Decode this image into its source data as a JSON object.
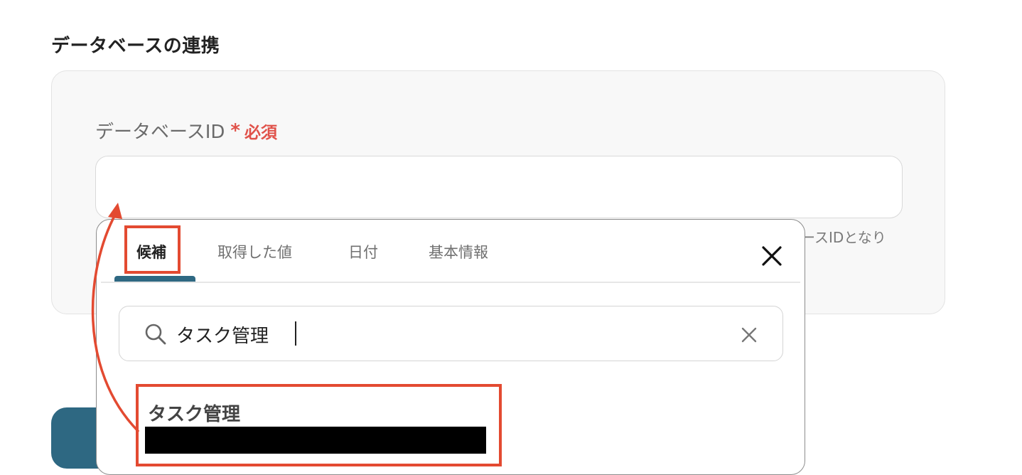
{
  "section": {
    "title": "データベースの連携"
  },
  "field": {
    "label": "データベースID",
    "required_star": "*",
    "required_text": "必須",
    "value": "",
    "hint": "ースIDとなり"
  },
  "popover": {
    "tabs": [
      {
        "label": "候補",
        "active": true
      },
      {
        "label": "取得した値",
        "active": false
      },
      {
        "label": "日付",
        "active": false
      },
      {
        "label": "基本情報",
        "active": false
      }
    ],
    "search": {
      "value": "タスク管理"
    },
    "results": [
      {
        "title": "タスク管理"
      }
    ]
  },
  "colors": {
    "accent": "#2e6882",
    "required": "#e0524a",
    "annotation": "#e34a31"
  },
  "icons": {
    "close": "close-icon",
    "search": "search-icon",
    "clear": "clear-icon"
  }
}
